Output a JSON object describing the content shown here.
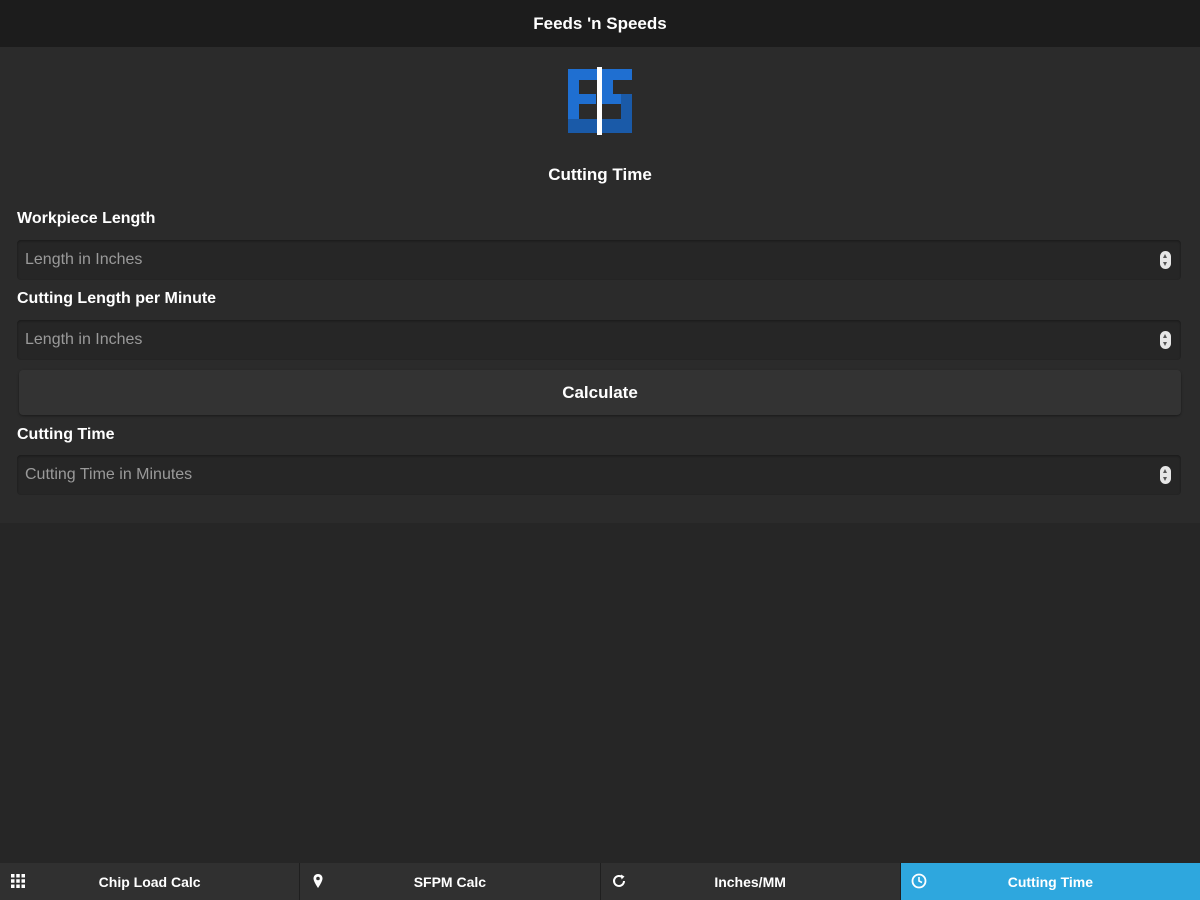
{
  "header": {
    "title": "Feeds 'n Speeds"
  },
  "logo": {
    "icon": "fs-logo-icon",
    "colors": [
      "#1f6fd1",
      "#1a5aa8",
      "#ffffff"
    ]
  },
  "main": {
    "section_title": "Cutting Time",
    "fields": [
      {
        "label": "Workpiece Length",
        "placeholder": "Length in Inches",
        "value": ""
      },
      {
        "label": "Cutting Length per Minute",
        "placeholder": "Length in Inches",
        "value": ""
      }
    ],
    "calculate_label": "Calculate",
    "result": {
      "label": "Cutting Time",
      "placeholder": "Cutting Time in Minutes",
      "value": ""
    }
  },
  "tabs": [
    {
      "label": "Chip Load Calc",
      "icon": "grid-icon",
      "active": false
    },
    {
      "label": "SFPM Calc",
      "icon": "map-pin-icon",
      "active": false
    },
    {
      "label": "Inches/MM",
      "icon": "refresh-icon",
      "active": false
    },
    {
      "label": "Cutting Time",
      "icon": "clock-icon",
      "active": true
    }
  ],
  "colors": {
    "accent": "#2ea7de",
    "background": "#262626",
    "panel": "#2b2b2b",
    "header": "#1c1c1c"
  }
}
